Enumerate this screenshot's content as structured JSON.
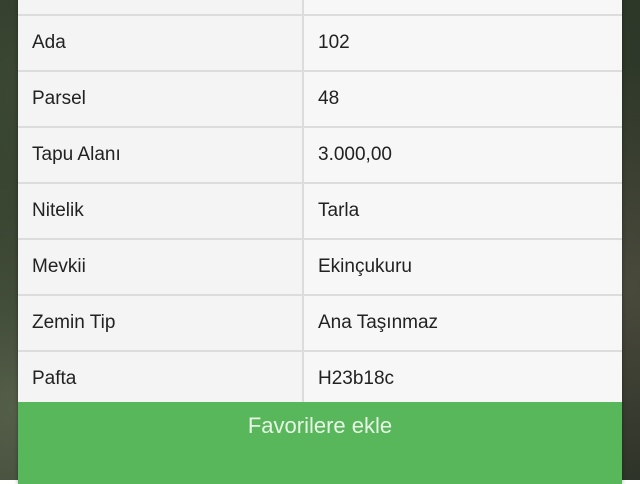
{
  "rows": [
    {
      "label": "",
      "value": ""
    },
    {
      "label": "Ada",
      "value": "102"
    },
    {
      "label": "Parsel",
      "value": "48"
    },
    {
      "label": "Tapu Alanı",
      "value": "3.000,00"
    },
    {
      "label": "Nitelik",
      "value": "Tarla"
    },
    {
      "label": "Mevkii",
      "value": "Ekinçukuru"
    },
    {
      "label": "Zemin Tip",
      "value": "Ana Taşınmaz"
    },
    {
      "label": "Pafta",
      "value": "H23b18c"
    }
  ],
  "actions": {
    "favorite_label": "Favorilere ekle"
  },
  "colors": {
    "button_green": "#58b75b",
    "row_border": "#dcdcdc"
  }
}
